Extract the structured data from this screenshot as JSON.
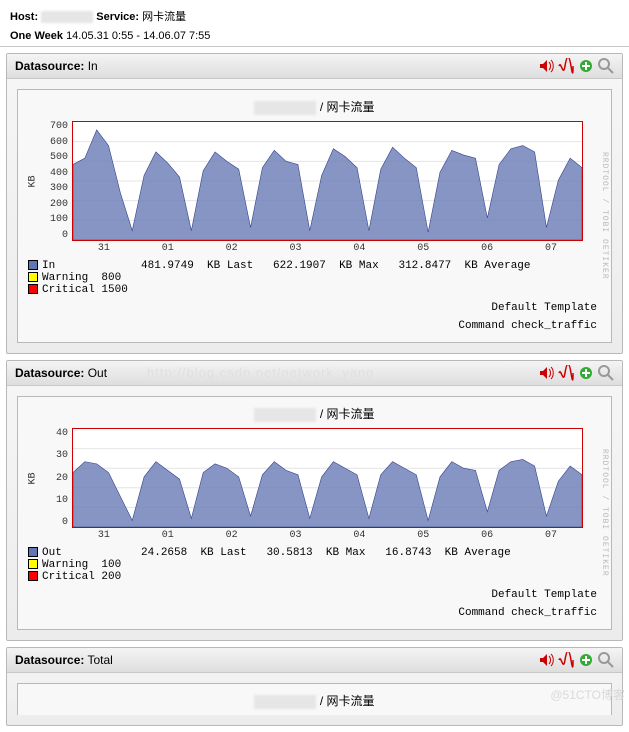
{
  "header": {
    "host_label": "Host:",
    "service_label": "Service:",
    "service_value": "网卡流量"
  },
  "timerange": {
    "label": "One Week",
    "value": "14.05.31 0:55 - 14.06.07 7:55"
  },
  "panels": {
    "in": {
      "title_prefix": "Datasource:",
      "title_name": "In"
    },
    "out": {
      "title_prefix": "Datasource:",
      "title_name": "Out"
    },
    "total": {
      "title_prefix": "Datasource:",
      "title_name": "Total"
    }
  },
  "graph_subtitle": "/ 网卡流量",
  "rrd_credit": "RRDTOOL / TOBI OETIKER",
  "ylabel": "KB",
  "template_line": "Default Template",
  "command_line": "Command check_traffic",
  "xticks": [
    "31",
    "01",
    "02",
    "03",
    "04",
    "05",
    "06",
    "07"
  ],
  "legend_in": {
    "series": "In",
    "stats": "481.9749  KB Last   622.1907  KB Max   312.8477  KB Average",
    "warn_label": "Warning",
    "warn_val": "800",
    "crit_label": "Critical",
    "crit_val": "1500"
  },
  "legend_out": {
    "series": "Out",
    "stats": "24.2658  KB Last   30.5813  KB Max   16.8743  KB Average",
    "warn_label": "Warning",
    "warn_val": "100",
    "crit_label": "Critical",
    "crit_val": "200"
  },
  "watermark_url": "http://blog.csdn.net/network_yang",
  "corner_watermark": "@51CTO博客",
  "chart_data": [
    {
      "type": "area",
      "title": "网卡流量 – In",
      "ylabel": "KB",
      "ylim": [
        0,
        750
      ],
      "yticks": [
        0,
        100,
        200,
        300,
        400,
        500,
        600,
        700
      ],
      "x_categories": [
        "31",
        "01",
        "02",
        "03",
        "04",
        "05",
        "06",
        "07"
      ],
      "series": [
        {
          "name": "In",
          "color": "#6176b4",
          "values": [
            480,
            520,
            700,
            600,
            300,
            60,
            410,
            560,
            490,
            400,
            60,
            440,
            560,
            500,
            450,
            80,
            460,
            570,
            500,
            480,
            60,
            410,
            580,
            530,
            460,
            60,
            450,
            590,
            520,
            460,
            50,
            430,
            570,
            540,
            520,
            140,
            480,
            580,
            600,
            560,
            80,
            380,
            520,
            460
          ]
        }
      ],
      "thresholds": {
        "warning": 800,
        "critical": 1500
      },
      "stats": {
        "last": 481.9749,
        "max": 622.1907,
        "average": 312.8477
      }
    },
    {
      "type": "area",
      "title": "网卡流量 – Out",
      "ylabel": "KB",
      "ylim": [
        0,
        45
      ],
      "yticks": [
        0,
        10,
        20,
        30,
        40
      ],
      "x_categories": [
        "31",
        "01",
        "02",
        "03",
        "04",
        "05",
        "06",
        "07"
      ],
      "series": [
        {
          "name": "Out",
          "color": "#6176b4",
          "values": [
            25,
            30,
            29,
            25,
            14,
            3,
            23,
            30,
            26,
            22,
            4,
            25,
            29,
            27,
            23,
            5,
            24,
            30,
            26,
            24,
            4,
            23,
            30,
            27,
            24,
            4,
            24,
            30,
            27,
            24,
            3,
            23,
            30,
            27,
            26,
            7,
            26,
            30,
            31,
            28,
            5,
            21,
            28,
            24
          ]
        }
      ],
      "thresholds": {
        "warning": 100,
        "critical": 200
      },
      "stats": {
        "last": 24.2658,
        "max": 30.5813,
        "average": 16.8743
      }
    }
  ]
}
